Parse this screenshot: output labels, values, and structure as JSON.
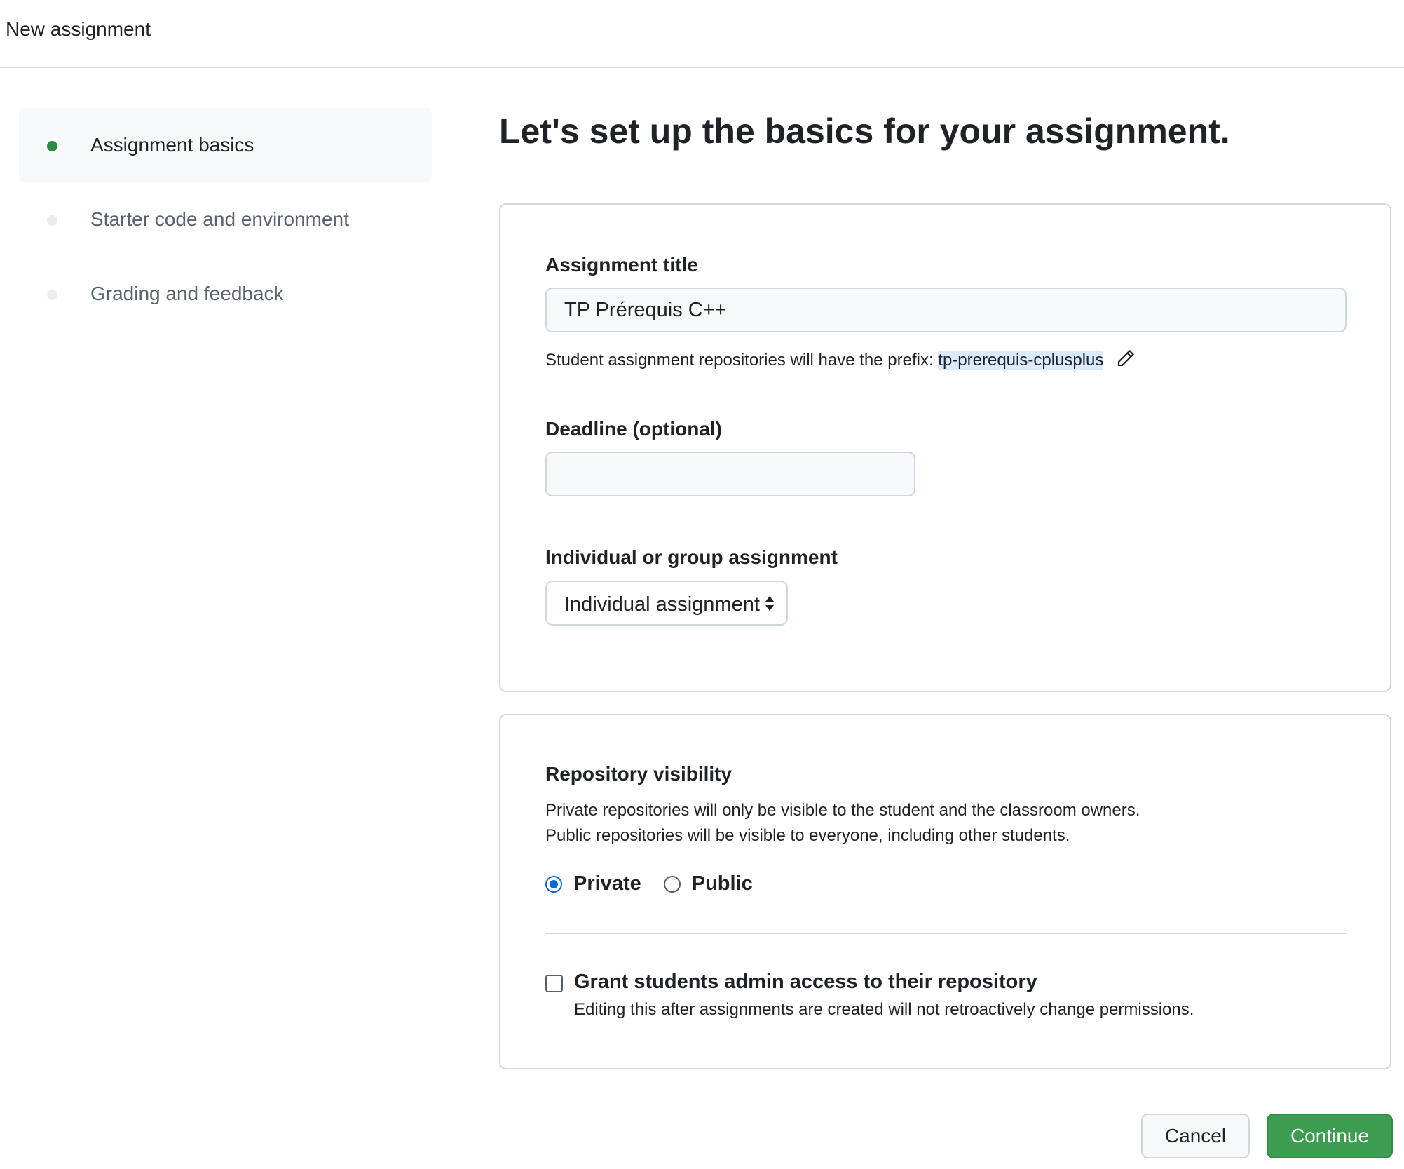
{
  "header": {
    "title": "New assignment"
  },
  "steps": [
    {
      "label": "Assignment basics",
      "state": "active"
    },
    {
      "label": "Starter code and environment",
      "state": "inactive"
    },
    {
      "label": "Grading and feedback",
      "state": "inactive"
    }
  ],
  "main": {
    "heading": "Let's set up the basics for your assignment.",
    "title_field": {
      "label": "Assignment title",
      "value": "TP Prérequis C++",
      "hint_prefix": "Student assignment repositories will have the prefix: ",
      "prefix_value": "tp-prerequis-cplusplus"
    },
    "deadline_field": {
      "label": "Deadline (optional)",
      "value": ""
    },
    "type_field": {
      "label": "Individual or group assignment",
      "selected": "Individual assignment"
    },
    "visibility": {
      "label": "Repository visibility",
      "desc_line1": "Private repositories will only be visible to the student and the classroom owners.",
      "desc_line2": "Public repositories will be visible to everyone, including other students.",
      "options": [
        {
          "label": "Private",
          "checked": true
        },
        {
          "label": "Public",
          "checked": false
        }
      ]
    },
    "admin_access": {
      "label": "Grant students admin access to their repository",
      "note": "Editing this after assignments are created will not retroactively change permissions.",
      "checked": false
    }
  },
  "actions": {
    "cancel_label": "Cancel",
    "continue_label": "Continue"
  },
  "colors": {
    "accent_green": "#3c9c50",
    "active_dot": "#2c8a44",
    "radio_blue": "#0969da",
    "prefix_highlight": "#dbeafe"
  },
  "icons": {
    "edit": "pencil-icon",
    "select": "select-arrows-icon"
  }
}
